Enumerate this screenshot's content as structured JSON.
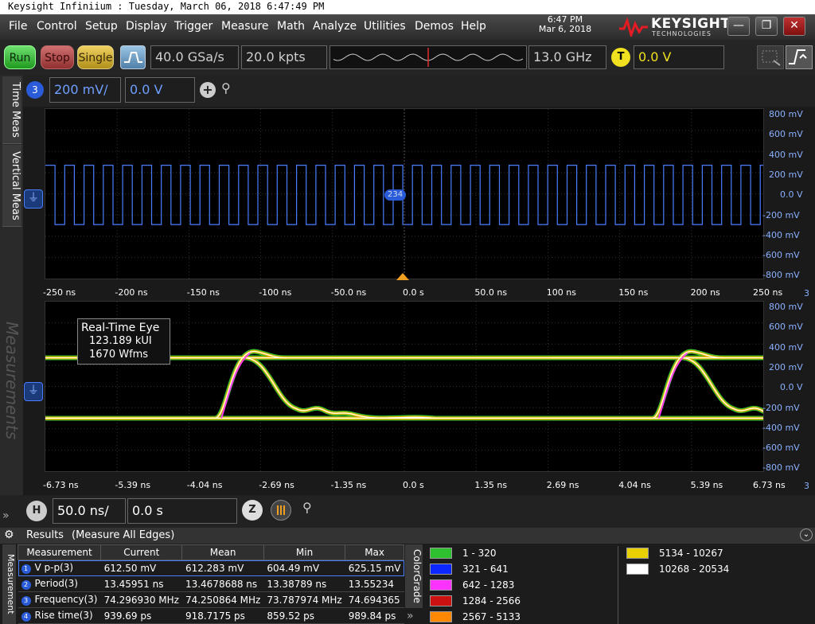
{
  "window": {
    "title": "Keysight Infiniium : Tuesday, March 06, 2018 6:47:49 PM"
  },
  "menu": [
    "File",
    "Control",
    "Setup",
    "Display",
    "Trigger",
    "Measure",
    "Math",
    "Analyze",
    "Utilities",
    "Demos",
    "Help"
  ],
  "clock": {
    "time": "6:47 PM",
    "date": "Mar 6, 2018"
  },
  "brand": {
    "name": "KEYSIGHT",
    "sub": "TECHNOLOGIES"
  },
  "window_controls": {
    "minimize": "—",
    "restore": "❐",
    "close": "✕"
  },
  "acquisition": {
    "run": "Run",
    "stop": "Stop",
    "single": "Single",
    "sample_rate": "40.0 GSa/s",
    "memory_depth": "20.0 kpts",
    "bandwidth": "13.0 GHz",
    "trigger_badge": "T",
    "trigger_level": "0.0 V"
  },
  "channel": {
    "number": "3",
    "scale": "200 mV/",
    "offset": "0.0 V"
  },
  "left_tabs": {
    "time_meas": "Time Meas",
    "vertical_meas": "Vertical Meas",
    "measurements": "Measurements"
  },
  "upper_panel": {
    "marker_label": "234",
    "x_ticks": [
      "-250 ns",
      "-200 ns",
      "-150 ns",
      "-100 ns",
      "-50.0 ns",
      "0.0 s",
      "50.0 ns",
      "100 ns",
      "150 ns",
      "200 ns",
      "250 ns"
    ],
    "y_ticks": [
      "800 mV",
      "600 mV",
      "400 mV",
      "200 mV",
      "0.0 V",
      "-200 mV",
      "-400 mV",
      "-600 mV",
      "-800 mV"
    ],
    "corner_label": "3",
    "square_wave": {
      "high_mv": 270,
      "low_mv": -290,
      "period_ns": 13.4568
    }
  },
  "lower_panel": {
    "eye_title": "Real-Time Eye",
    "eye_ui": "123.189 kUI",
    "eye_wfms": "1670 Wfms",
    "x_ticks": [
      "-6.73 ns",
      "-5.39 ns",
      "-4.04 ns",
      "-2.69 ns",
      "-1.35 ns",
      "0.0 s",
      "1.35 ns",
      "2.69 ns",
      "4.04 ns",
      "5.39 ns",
      "6.73 ns"
    ],
    "y_ticks": [
      "800 mV",
      "600 mV",
      "400 mV",
      "200 mV",
      "0.0 V",
      "-200 mV",
      "-400 mV",
      "-600 mV",
      "-800 mV"
    ],
    "corner_label": "3",
    "eye": {
      "high_mv": 270,
      "low_mv": -300,
      "rising_edges_ns": [
        -3.4,
        4.8
      ],
      "falling_edges_ns": [
        -2.4,
        5.8
      ]
    }
  },
  "horizontal": {
    "badge": "H",
    "scale": "50.0 ns/",
    "position": "0.0 s",
    "zoom_icon": "Z"
  },
  "results": {
    "title": "Results",
    "mode": "(Measure All Edges)",
    "side_tab": "Measurement",
    "columns": [
      "Measurement",
      "Current",
      "Mean",
      "Min",
      "Max"
    ],
    "rows": [
      {
        "index": "1",
        "name": "V p-p(3)",
        "current": "612.50 mV",
        "mean": "612.283 mV",
        "min": "604.49 mV",
        "max": "625.15 mV"
      },
      {
        "index": "2",
        "name": "Period(3)",
        "current": "13.45951 ns",
        "mean": "13.4678688 ns",
        "min": "13.38789 ns",
        "max": "13.55234"
      },
      {
        "index": "3",
        "name": "Frequency(3)",
        "current": "74.296930 MHz",
        "mean": "74.250864 MHz",
        "min": "73.787974 MHz",
        "max": "74.694365"
      },
      {
        "index": "4",
        "name": "Rise time(3)",
        "current": "939.69 ps",
        "mean": "918.7175 ps",
        "min": "859.52 ps",
        "max": "989.84 ps"
      }
    ]
  },
  "colorgrade": {
    "tab_label": "ColorGrade",
    "bins": [
      {
        "label": "1 - 320",
        "color": "#2fc02f"
      },
      {
        "label": "321 - 641",
        "color": "#0a28ff"
      },
      {
        "label": "642 - 1283",
        "color": "#ff33ff"
      },
      {
        "label": "1284 - 2566",
        "color": "#cc1111"
      },
      {
        "label": "2567 - 5133",
        "color": "#ff8800"
      },
      {
        "label": "5134 - 10267",
        "color": "#e8d000"
      },
      {
        "label": "10268 - 20534",
        "color": "#ffffff"
      }
    ]
  },
  "colors": {
    "trace": "#4a7dff",
    "axis_text": "#8ab0ff",
    "trigger_marker": "#f0a020"
  }
}
